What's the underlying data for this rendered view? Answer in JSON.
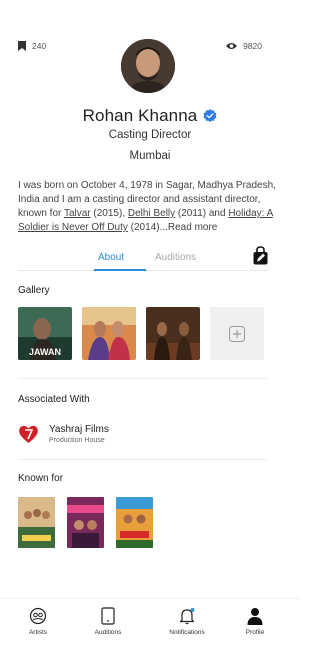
{
  "stats": {
    "bookmarks": "240",
    "views": "9820"
  },
  "profile": {
    "name": "Rohan Khanna",
    "role": "Casting Director",
    "city": "Mumbai",
    "bio": {
      "line1": "I was born on October 4, 1978 in Sagar, Madhya Pradesh,",
      "line2": "India and I am a casting director and assistant director,",
      "line3_pre": "known for ",
      "film1": "Talvar",
      "film1_year": " (2015), ",
      "film2": "Delhi Belly",
      "film2_year": " (2011) and ",
      "film3a": "Holiday: A",
      "film3b": "Soldier is Never Off Duty",
      "film3_year": " (2014)...",
      "read_more": "Read more"
    }
  },
  "tabs": {
    "about": "About",
    "auditions": "Auditions"
  },
  "sections": {
    "gallery": "Gallery",
    "associated": "Associated With",
    "known_for": "Known for"
  },
  "gallery": {
    "poster1_text": "JAWAN"
  },
  "association": {
    "name": "Yashraj Films",
    "type": "Production House"
  },
  "nav": {
    "artists": "Artists",
    "auditions": "Auditions",
    "notifications": "Notifications",
    "profile": "Profile"
  },
  "colors": {
    "accent": "#2d8fd6",
    "verified": "#2f7de1",
    "yrf_red": "#d11f26"
  }
}
